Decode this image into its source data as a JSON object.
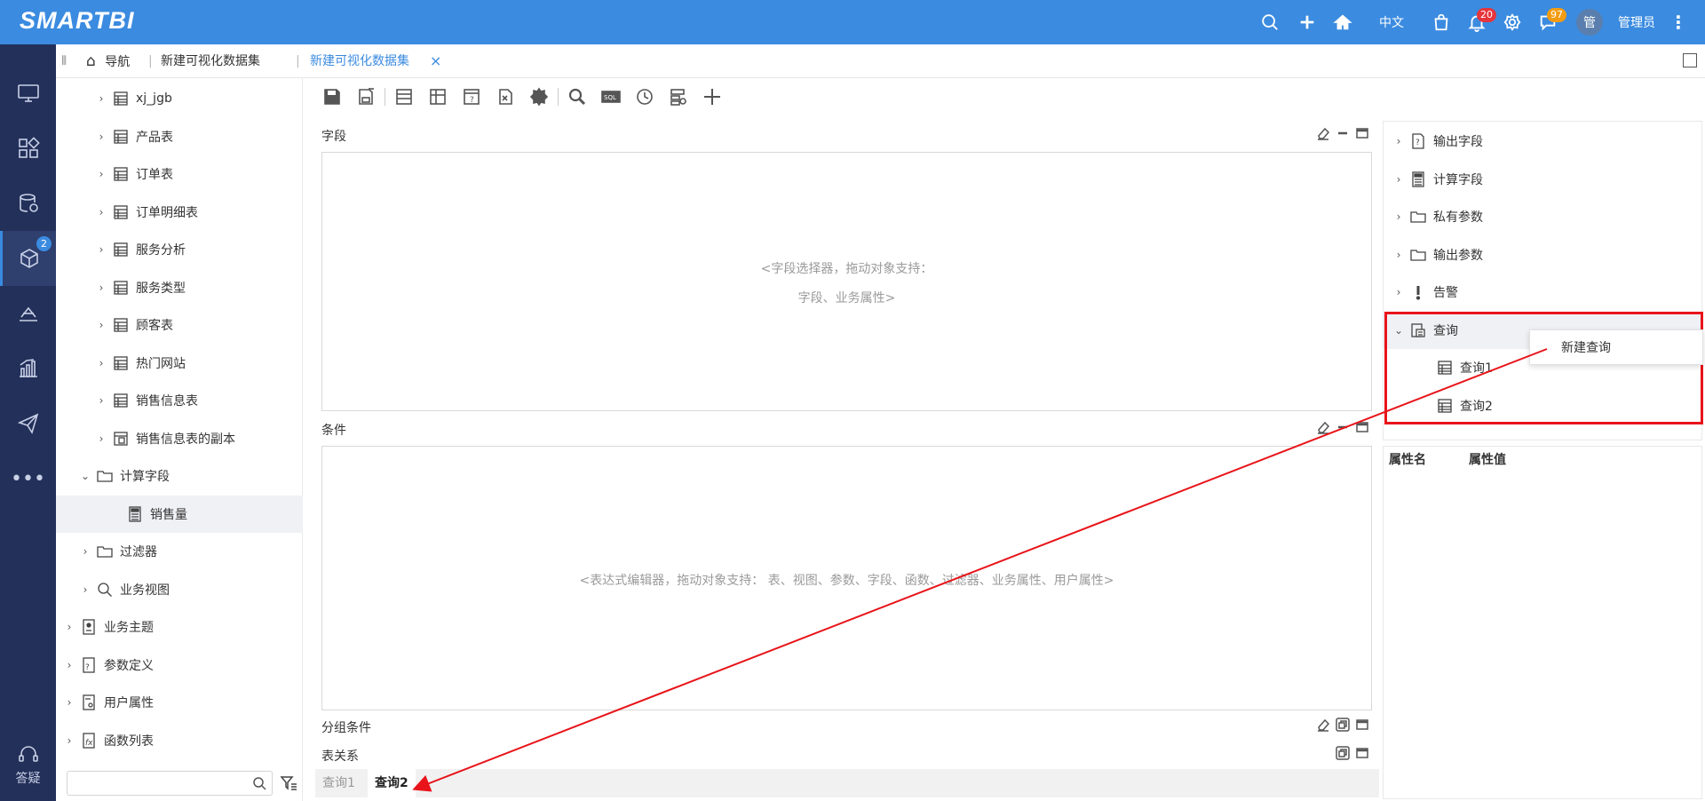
{
  "topbar": {
    "logo": "SMARTBI",
    "lang": "中文",
    "notifications_count": "20",
    "messages_count": "97",
    "avatar_char": "管",
    "user_name": "管理员"
  },
  "leftnav": {
    "badge": "2",
    "help_label": "答疑"
  },
  "tabs": {
    "nav_label": "导航",
    "tab1": "新建可视化数据集",
    "tab2": "新建可视化数据集",
    "close": "×"
  },
  "tree": {
    "items": [
      {
        "label": "xj_jgb",
        "icon": "table-icon"
      },
      {
        "label": "产品表",
        "icon": "table-icon"
      },
      {
        "label": "订单表",
        "icon": "table-icon"
      },
      {
        "label": "订单明细表",
        "icon": "table-icon"
      },
      {
        "label": "服务分析",
        "icon": "table-icon"
      },
      {
        "label": "服务类型",
        "icon": "table-icon"
      },
      {
        "label": "顾客表",
        "icon": "table-icon"
      },
      {
        "label": "热门网站",
        "icon": "table-icon"
      },
      {
        "label": "销售信息表",
        "icon": "table-icon"
      },
      {
        "label": "销售信息表的副本",
        "icon": "table-copy-icon"
      },
      {
        "label": "计算字段",
        "icon": "folder-icon"
      },
      {
        "label": "销售量",
        "icon": "calculator-icon"
      },
      {
        "label": "过滤器",
        "icon": "folder-icon"
      },
      {
        "label": "业务视图",
        "icon": "search-icon"
      },
      {
        "label": "业务主题",
        "icon": "theme-icon"
      },
      {
        "label": "参数定义",
        "icon": "param-icon"
      },
      {
        "label": "用户属性",
        "icon": "user-attr-icon"
      },
      {
        "label": "函数列表",
        "icon": "function-icon"
      }
    ],
    "search_value": ""
  },
  "editor": {
    "fields_title": "字段",
    "fields_hint_line1": "<字段选择器，拖动对象支持：",
    "fields_hint_line2": "字段、业务属性>",
    "conditions_title": "条件",
    "conditions_hint": "<表达式编辑器，拖动对象支持： 表、视图、参数、字段、函数、过滤器、业务属性、用户属性>",
    "group_title": "分组条件",
    "relation_title": "表关系",
    "bottom_tabs": [
      "查询1",
      "查询2"
    ]
  },
  "right": {
    "items": [
      {
        "label": "输出字段",
        "icon": "output-field-icon"
      },
      {
        "label": "计算字段",
        "icon": "calculator-icon"
      },
      {
        "label": "私有参数",
        "icon": "folder-icon"
      },
      {
        "label": "输出参数",
        "icon": "folder-icon"
      },
      {
        "label": "告警",
        "icon": "alert-icon"
      },
      {
        "label": "查询",
        "icon": "query-icon"
      },
      {
        "label": "查询1",
        "icon": "table-icon"
      },
      {
        "label": "查询2",
        "icon": "table-icon"
      }
    ],
    "context_menu_item": "新建查询",
    "prop_name_header": "属性名",
    "prop_value_header": "属性值"
  }
}
